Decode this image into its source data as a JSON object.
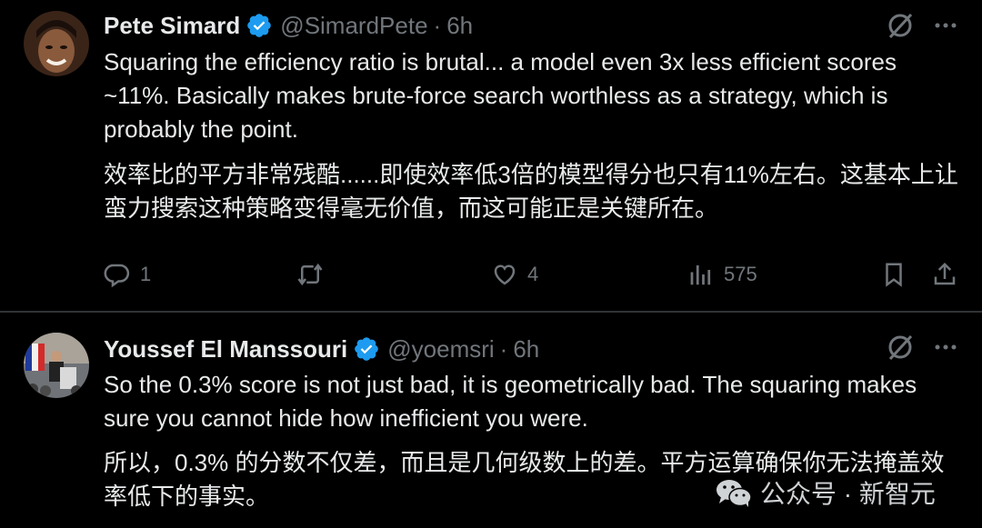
{
  "tweets": [
    {
      "name": "Pete Simard",
      "handle": "@SimardPete",
      "separator": "·",
      "time": "6h",
      "text_en": "Squaring the efficiency ratio is brutal... a model even 3x less efficient scores ~11%. Basically makes brute-force search worthless as a strategy, which is probably the point.",
      "text_zh": "效率比的平方非常残酷......即使效率低3倍的模型得分也只有11%左右。这基本上让蛮力搜索这种策略变得毫无价值，而这可能正是关键所在。",
      "stats": {
        "replies": "1",
        "likes": "4",
        "views": "575"
      }
    },
    {
      "name": "Youssef El Manssouri",
      "handle": "@yoemsri",
      "separator": "·",
      "time": "6h",
      "text_en": "So the 0.3% score is not just bad, it is geometrically bad. The squaring makes sure you cannot hide how inefficient you were.",
      "text_zh": "所以，0.3% 的分数不仅差，而且是几何级数上的差。平方运算确保你无法掩盖效率低下的事实。"
    }
  ],
  "watermark": "公众号 · 新智元",
  "icons": {
    "verified": "verified-badge-icon",
    "grok": "grok-icon",
    "more": "more-icon",
    "reply": "reply-icon",
    "retweet": "retweet-icon",
    "like": "like-icon",
    "views": "views-icon",
    "bookmark": "bookmark-icon",
    "share": "share-icon"
  },
  "colors": {
    "background": "#000000",
    "text": "#e7e9ea",
    "secondary": "#71767b",
    "verified": "#1d9bf0",
    "divider": "#2f3336"
  }
}
